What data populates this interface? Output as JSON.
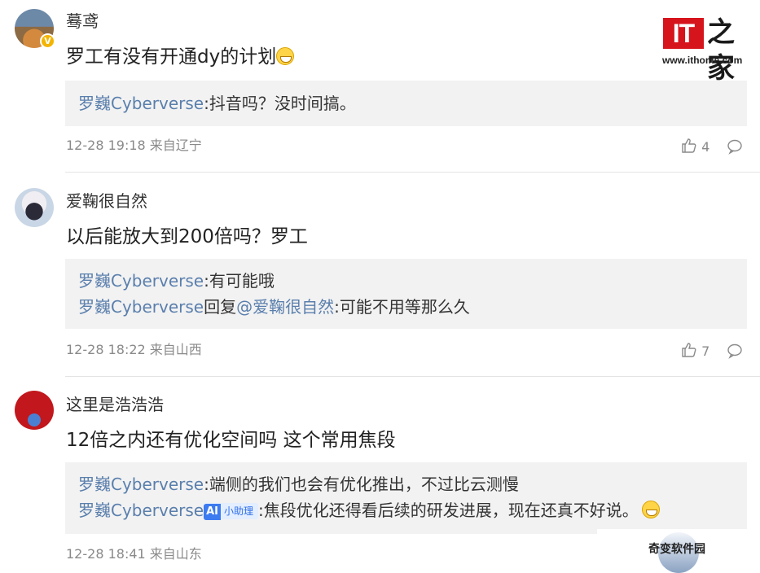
{
  "logo": {
    "it": "IT",
    "cn": "之家",
    "url": "www.ithome.com"
  },
  "watermark": "奇变软件园",
  "comments": [
    {
      "username": "蓦鸢",
      "verified": true,
      "text": "罗工有没有开通dy的计划",
      "replies": [
        {
          "author": "罗巍Cyberverse",
          "sep": ":",
          "text": "抖音吗？没时间搞。"
        }
      ],
      "meta": "12-28 19:18 来自辽宁",
      "likes": "4"
    },
    {
      "username": "爱鞠很自然",
      "text": "以后能放大到200倍吗？罗工",
      "replies": [
        {
          "author": "罗巍Cyberverse",
          "sep": ":",
          "text": "有可能哦"
        },
        {
          "author": "罗巍Cyberverse",
          "mid": "回复",
          "mention": "@爱鞠很自然",
          "sep": ":",
          "text": "可能不用等那么久"
        }
      ],
      "meta": "12-28 18:22 来自山西",
      "likes": "7"
    },
    {
      "username": "这里是浩浩浩",
      "text": "12倍之内还有优化空间吗 这个常用焦段",
      "replies": [
        {
          "author": "罗巍Cyberverse",
          "sep": ":",
          "text": "端侧的我们也会有优化推出，不过比云测慢"
        },
        {
          "author": "罗巍Cyberverse",
          "badge_ai": "AI",
          "badge_label": "小助理",
          "sep": ":",
          "text": "焦段优化还得看后续的研发进展，现在还真不好说。"
        }
      ],
      "meta": "12-28 18:41 来自山东"
    }
  ],
  "icons": [
    "thumbs-up-icon",
    "comment-icon",
    "grin-emoji-icon",
    "laugh-tears-emoji-icon"
  ],
  "colors": {
    "link": "#5a7fad",
    "reply_bg": "#f2f2f2",
    "logo_red": "#d6141c",
    "ai_blue": "#3d7bf0"
  }
}
